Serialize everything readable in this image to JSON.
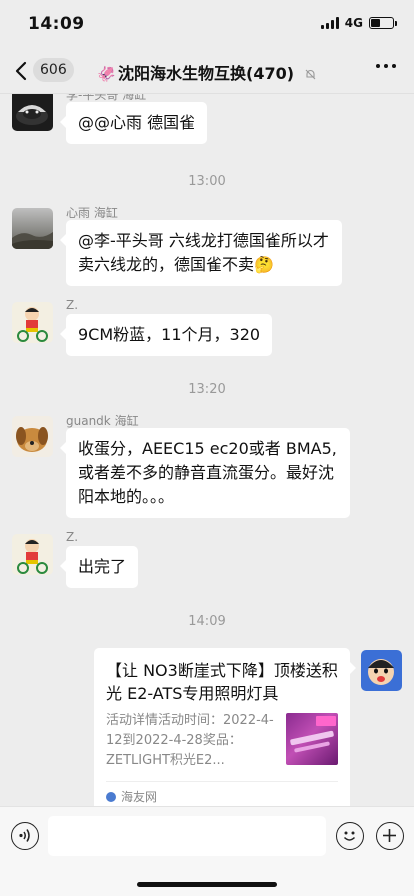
{
  "status_bar": {
    "time": "14:09",
    "network": "4G"
  },
  "nav": {
    "back_count": "606",
    "title_emoji": "🦑",
    "title": "沈阳海水生物互换(470)"
  },
  "messages": [
    {
      "kind": "incoming",
      "sender": "李-平头哥 海缸",
      "text": "@@心雨 德国雀"
    },
    {
      "kind": "time",
      "text": "13:00"
    },
    {
      "kind": "incoming",
      "sender": "心雨 海缸",
      "text": "@李-平头哥 六线龙打德国雀所以才卖六线龙的，德国雀不卖🤔"
    },
    {
      "kind": "incoming",
      "sender": "Z.",
      "text": "9CM粉蓝，11个月，320"
    },
    {
      "kind": "time",
      "text": "13:20"
    },
    {
      "kind": "incoming",
      "sender": "guandk 海缸",
      "text": "收蛋分，AEEC15 ec20或者 BMA5,或者差不多的静音直流蛋分。最好沈阳本地的。。。"
    },
    {
      "kind": "incoming",
      "sender": "Z.",
      "text": "出完了"
    },
    {
      "kind": "time",
      "text": "14:09"
    }
  ],
  "link_card": {
    "title": "【让 NO3断崖式下降】顶楼送积光 E2-ATS专用照明灯具",
    "description": "活动详情活动时间：2022-4-12到2022-4-28奖品：ZETLIGHT积光E2...",
    "source": "海友网"
  },
  "input": {
    "value": ""
  },
  "colors": {
    "background": "#ededed",
    "bubble": "#ffffff",
    "meta_text": "#888888"
  }
}
